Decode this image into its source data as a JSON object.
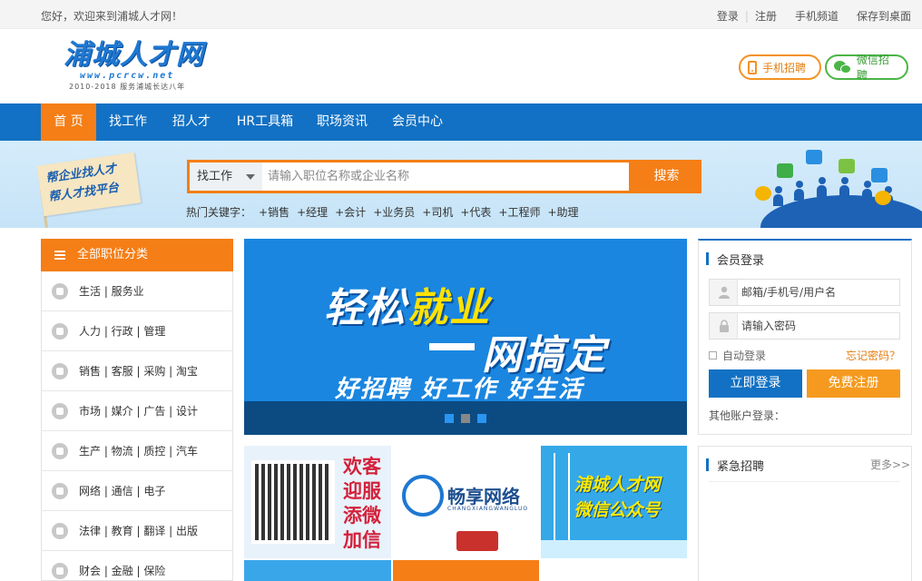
{
  "topbar": {
    "welcome": "您好，欢迎来到浦城人才网！",
    "login": "登录",
    "register": "注册",
    "mobile_channel": "手机频道",
    "save_desktop": "保存到桌面"
  },
  "header": {
    "logo_main": "浦城人才网",
    "logo_url": "www.pcrcw.net",
    "logo_slogan": "2010-2018 服务浦城长达八年",
    "mobile_recruit": "手机招聘",
    "wechat_recruit": "微信招聘",
    "colors": {
      "accent_orange": "#f57e16",
      "nav_blue": "#1271c4",
      "wechat_green": "#4bb546"
    }
  },
  "nav": {
    "items": [
      {
        "label": "首 页",
        "active": true
      },
      {
        "label": "找工作",
        "active": false
      },
      {
        "label": "招人才",
        "active": false
      },
      {
        "label": "HR工具箱",
        "active": false
      },
      {
        "label": "职场资讯",
        "active": false
      },
      {
        "label": "会员中心",
        "active": false
      }
    ]
  },
  "banner": {
    "flag_line1": "帮企业找人才",
    "flag_line2": "帮人才找平台",
    "search_type": "找工作",
    "search_placeholder": "请输入职位名称或企业名称",
    "search_button": "搜索",
    "hot_label": "热门关键字：",
    "hot_keywords": [
      "+销售",
      "+经理",
      "+会计",
      "+业务员",
      "+司机",
      "+代表",
      "+工程师",
      "+助理"
    ]
  },
  "categories": {
    "title": "全部职位分类",
    "items": [
      {
        "label": "生活 | 服务业",
        "icon": "life-service-icon"
      },
      {
        "label": "人力 | 行政 | 管理",
        "icon": "hr-admin-icon"
      },
      {
        "label": "销售 | 客服 | 采购 | 淘宝",
        "icon": "sales-icon"
      },
      {
        "label": "市场 | 媒介 | 广告 | 设计",
        "icon": "marketing-icon"
      },
      {
        "label": "生产 | 物流 | 质控 | 汽车",
        "icon": "production-icon"
      },
      {
        "label": "网络 | 通信 | 电子",
        "icon": "network-icon"
      },
      {
        "label": "法律 | 教育 | 翻译 | 出版",
        "icon": "law-education-icon"
      },
      {
        "label": "财会 | 金融 | 保险",
        "icon": "finance-icon"
      }
    ]
  },
  "slider": {
    "line1_a": "轻松",
    "line1_b": "就业",
    "line2": "网搞定",
    "line3": "好招聘 好工作 好生活",
    "dots": 3,
    "active_dot": 2
  },
  "ads": {
    "ad1_text": "欢客迎服添微加信",
    "ad2_name": "畅享网络",
    "ad2_pinyin": "CHANGXIANGWANGLUO",
    "ad3_line1": "浦城人才网",
    "ad3_line2": "微信公众号"
  },
  "login": {
    "title": "会员登录",
    "username_placeholder": "邮箱/手机号/用户名",
    "password_placeholder": "请输入密码",
    "remember": "自动登录",
    "forgot": "忘记密码？",
    "login_button": "立即登录",
    "register_button": "免费注册",
    "other": "其他账户登录："
  },
  "urgent": {
    "title": "紧急招聘",
    "more": "更多>>"
  }
}
